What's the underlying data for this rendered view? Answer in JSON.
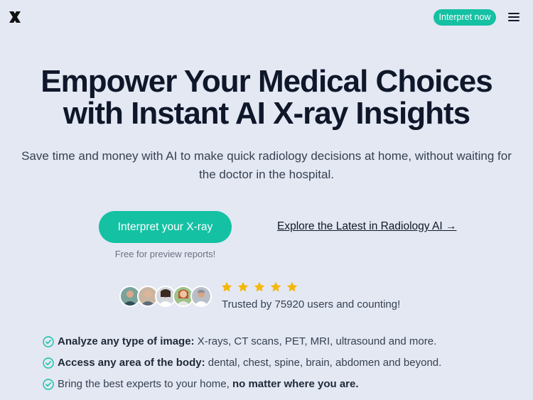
{
  "header": {
    "logo_icon": "x-logo-icon",
    "cta_label": "Interpret now",
    "menu_icon": "hamburger-menu-icon"
  },
  "hero": {
    "title_line1": "Empower Your Medical Choices",
    "title_line2": "with Instant AI X-ray Insights",
    "subtitle": "Save time and money with AI to make quick radiology decisions at home, without waiting for the doctor in the hospital.",
    "primary_cta": "Interpret your X-ray",
    "primary_note": "Free for preview reports!",
    "secondary_link": "Explore the Latest in Radiology AI →"
  },
  "social_proof": {
    "avatar_count": 5,
    "rating": 5,
    "trusted_text": "Trusted by 75920 users and counting!"
  },
  "features": [
    {
      "bold": "Analyze any type of image:",
      "rest": " X-rays, CT scans, PET, MRI, ultrasound and more."
    },
    {
      "bold": "Access any area of the body:",
      "rest": " dental, chest, spine, brain, abdomen and beyond."
    },
    {
      "lead": "Bring the best experts to your home, ",
      "bold": "no matter where you are."
    }
  ],
  "colors": {
    "accent": "#14c1a3",
    "background": "#e3e8f3",
    "star": "#f5b70a",
    "heading": "#0f172a"
  }
}
